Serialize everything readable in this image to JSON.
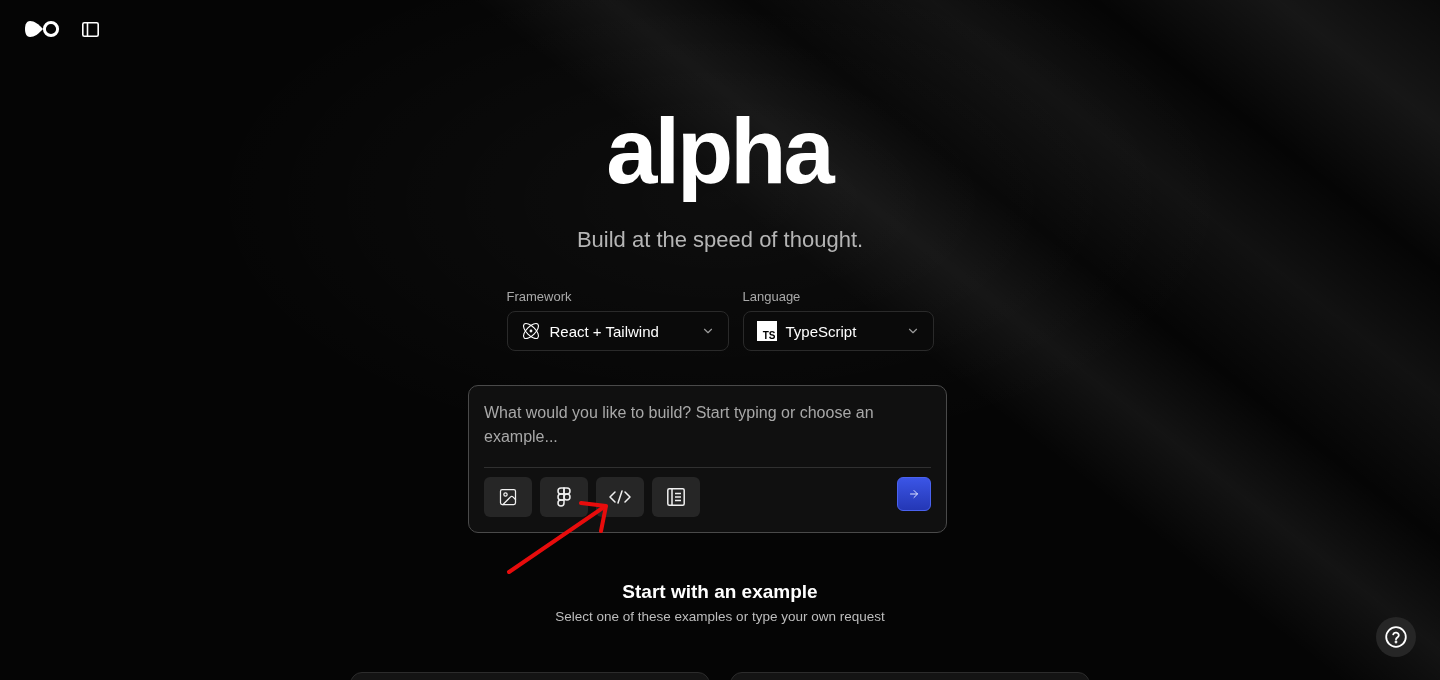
{
  "logo": {
    "text": "alpha"
  },
  "tagline": "Build at the speed of thought.",
  "selectors": [
    {
      "label": "Framework",
      "value": "React + Tailwind",
      "kind": "atom"
    },
    {
      "label": "Language",
      "value": "TypeScript",
      "kind": "badge",
      "badge": "TS"
    }
  ],
  "prompt": {
    "placeholder": "What would you like to build? Start typing or choose an example...",
    "attachments": [
      {
        "kind": "image"
      },
      {
        "kind": "figma"
      },
      {
        "kind": "code"
      },
      {
        "kind": "document"
      }
    ]
  },
  "examples": {
    "title": "Start with an example",
    "subtitle": "Select one of these examples or type your own request"
  }
}
